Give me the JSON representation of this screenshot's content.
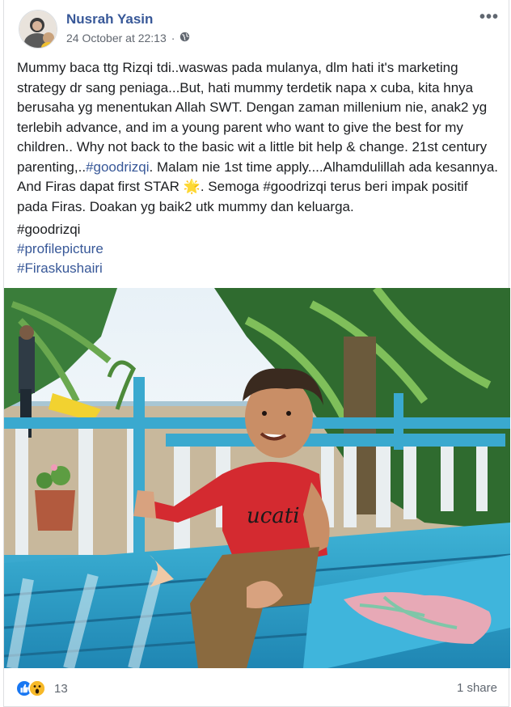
{
  "post": {
    "author": "Nusrah Yasin",
    "timestamp": "24 October at 22:13",
    "privacy_icon": "globe-icon",
    "more_icon": "more-horizontal-icon",
    "body_part1": "Mummy baca ttg Rizqi tdi..waswas pada mulanya, dlm hati it's marketing strategy dr sang peniaga...But, hati mummy terdetik napa x cuba, kita hnya berusaha yg menentukan Allah SWT. Dengan zaman millenium nie, anak2 yg terlebih advance, and im a young parent who want to give the best for my children.. Why not back to the basic wit a little bit help & change. 21st century parenting,..",
    "body_tag1": "#goodrizqi",
    "body_part2": ". Malam nie 1st time apply....Alhamdulillah ada kesannya. And Firas dapat first STAR ",
    "body_emoji": "🌟",
    "body_part3": ". Semoga #goodrizqi terus beri impak positif pada Firas. Doakan yg baik2 utk mummy dan keluarga.",
    "hashtag_plain": "#goodrizqi",
    "hashtag_link1": "#profilepicture",
    "hashtag_link2": "#Firaskushairi"
  },
  "footer": {
    "reaction_icons": [
      "like-icon",
      "wow-icon"
    ],
    "reaction_count": "13",
    "share_text": "1 share"
  },
  "colors": {
    "link": "#385898",
    "meta": "#616770",
    "like": "#1877f2",
    "wow": "#f7b928"
  }
}
